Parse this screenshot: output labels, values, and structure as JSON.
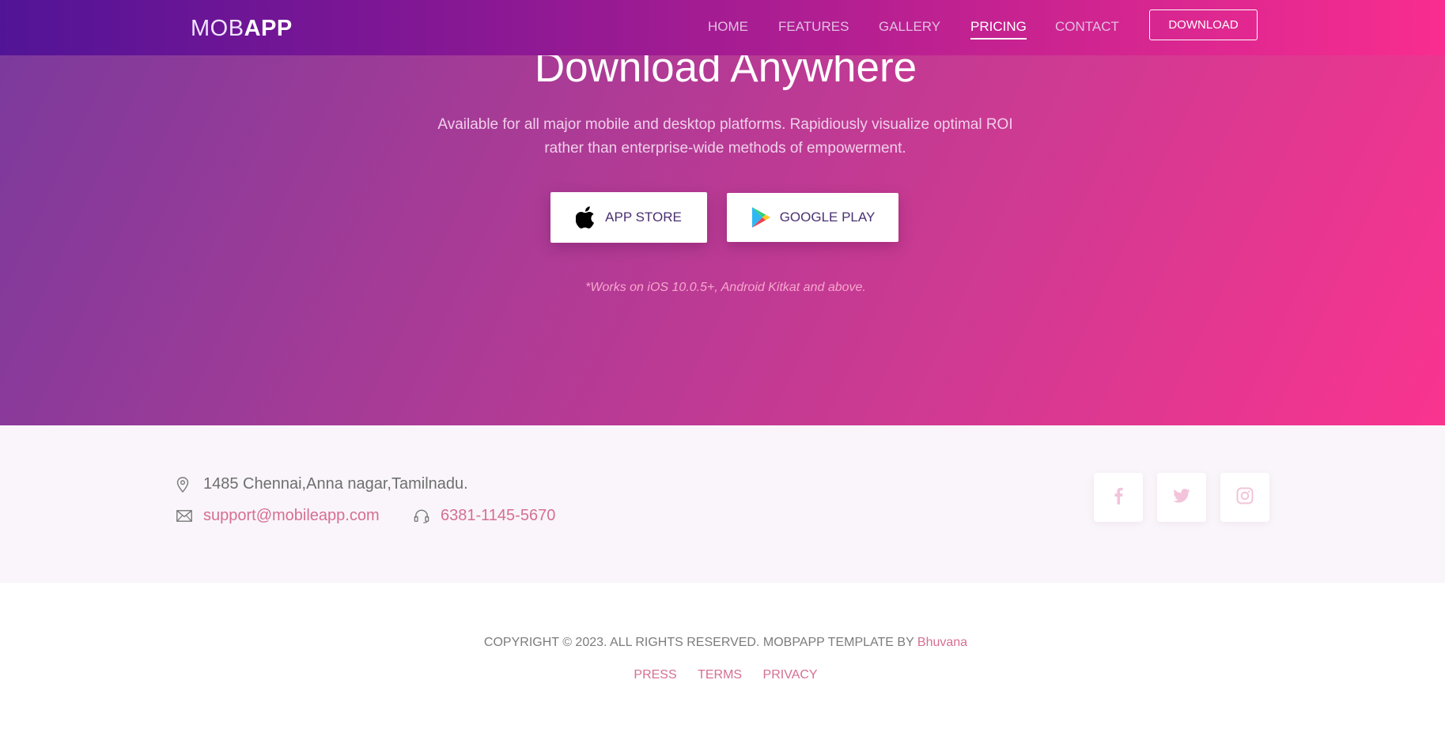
{
  "brand": {
    "light": "MOB",
    "bold": "APP"
  },
  "nav": {
    "items": [
      {
        "label": "HOME",
        "active": false
      },
      {
        "label": "FEATURES",
        "active": false
      },
      {
        "label": "GALLERY",
        "active": false
      },
      {
        "label": "PRICING",
        "active": true
      },
      {
        "label": "CONTACT",
        "active": false
      }
    ],
    "download_label": "DOWNLOAD"
  },
  "hero": {
    "title": "Download Anywhere",
    "description_line1": "Available for all major mobile and desktop platforms. Rapidiously visualize optimal ROI",
    "description_line2": "rather than enterprise-wide methods of empowerment.",
    "app_store_label": "APP STORE",
    "google_play_label": "GOOGLE PLAY",
    "note": "*Works on iOS 10.0.5+, Android Kitkat and above."
  },
  "contact": {
    "address": "1485 Chennai,Anna nagar,Tamilnadu.",
    "email": "support@mobileapp.com",
    "phone": "6381-1145-5670",
    "social_icons": [
      "facebook-icon",
      "twitter-icon",
      "instagram-icon"
    ]
  },
  "footer": {
    "copyright": "COPYRIGHT © 2023. ALL RIGHTS RESERVED. MOBPAPP TEMPLATE BY",
    "author": "Bhuvana",
    "links": [
      "PRESS",
      "TERMS",
      "PRIVACY"
    ]
  },
  "colors": {
    "nav_start": "#521496",
    "nav_end": "#f92d8f",
    "accent_pink": "#d66f92",
    "button_text": "#4a2f72"
  }
}
